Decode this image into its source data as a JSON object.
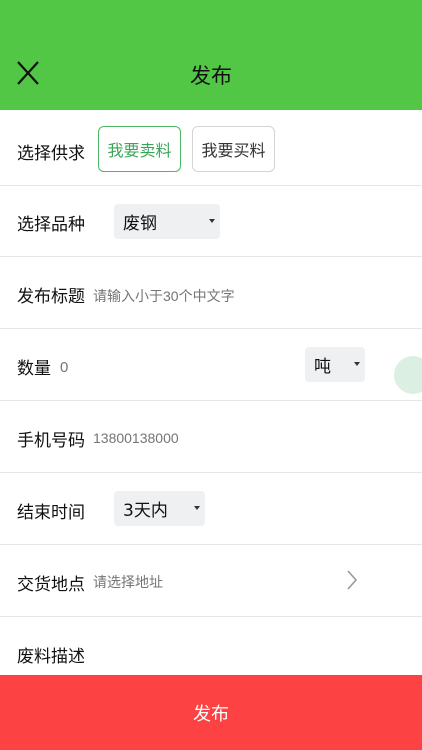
{
  "header": {
    "title": "发布",
    "close_icon": "close-icon"
  },
  "supply": {
    "label": "选择供求",
    "options": [
      "我要卖料",
      "我要买料"
    ],
    "selected": "我要卖料"
  },
  "variety": {
    "label": "选择品种",
    "value": "废钢"
  },
  "title_field": {
    "label": "发布标题",
    "placeholder": "请输入小于30个中文字"
  },
  "quantity": {
    "label": "数量",
    "placeholder": "0",
    "unit": "吨"
  },
  "phone": {
    "label": "手机号码",
    "placeholder": "13800138000"
  },
  "end_time": {
    "label": "结束时间",
    "value": "3天内"
  },
  "delivery": {
    "label": "交货地点",
    "placeholder": "请选择地址",
    "arrow_icon": "chevron-right-icon"
  },
  "description": {
    "label": "废料描述"
  },
  "submit": {
    "label": "发布"
  },
  "colors": {
    "header_bg": "#52c645",
    "selected_text": "#3ca45a",
    "submit_bg": "#fc4242"
  }
}
